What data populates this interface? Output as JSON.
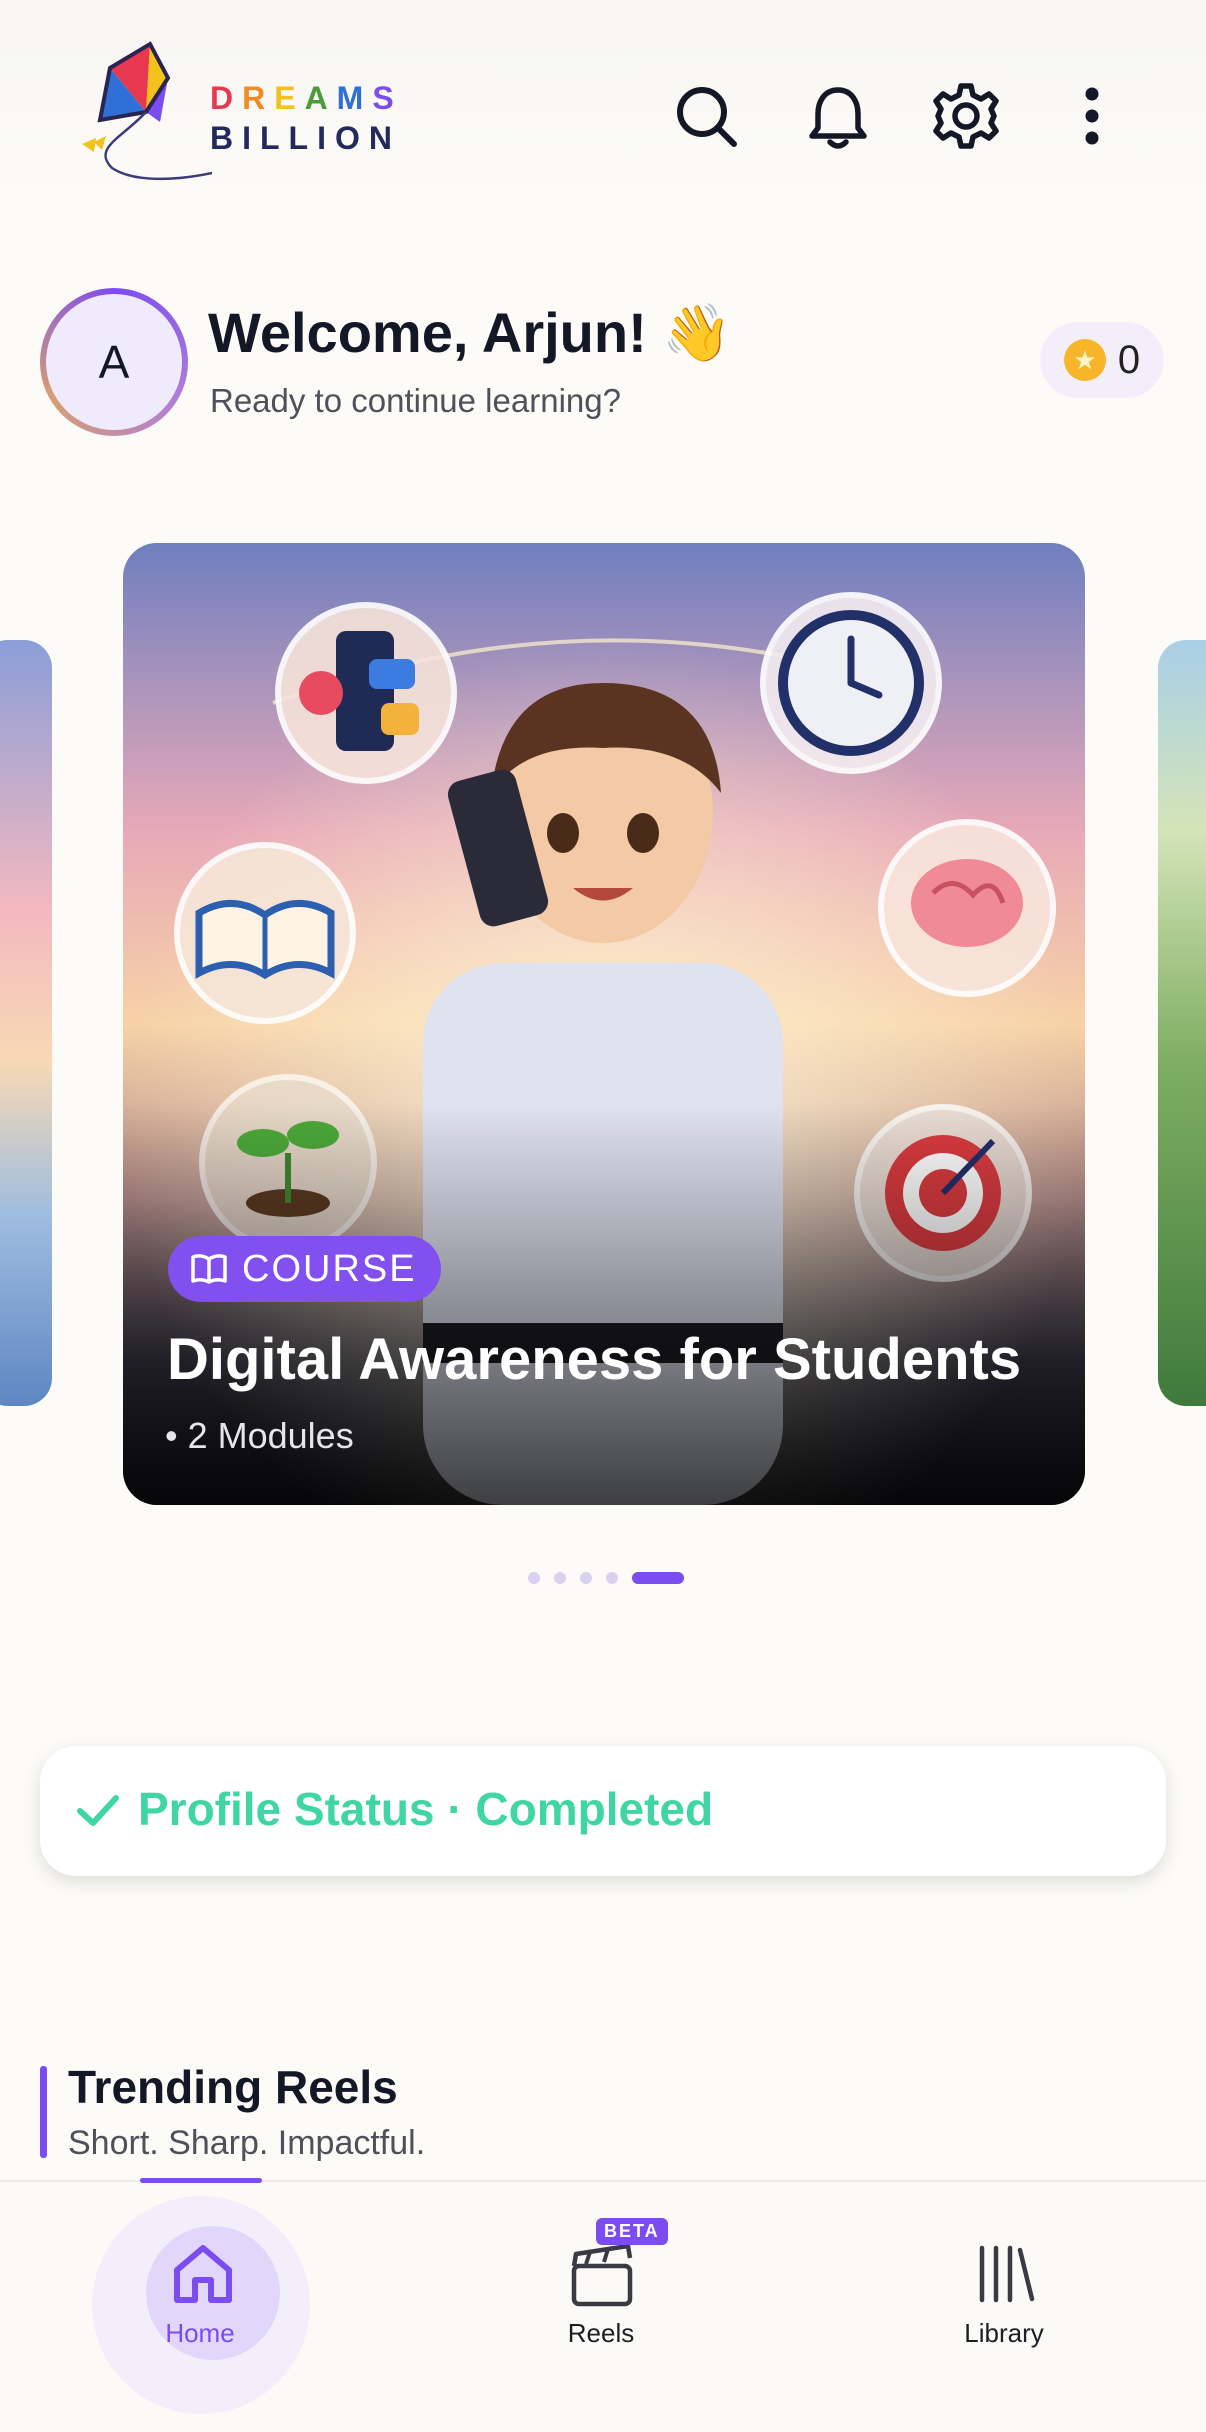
{
  "brand": {
    "line1": "DREAMS",
    "line2": "BILLION"
  },
  "header": {
    "icons": [
      "search-icon",
      "bell-icon",
      "gear-icon",
      "more-vertical-icon"
    ]
  },
  "user": {
    "initial": "A",
    "welcome": "Welcome, Arjun! 👋",
    "subtitle": "Ready to continue learning?",
    "points": "0"
  },
  "carousel": {
    "badge": "COURSE",
    "title": "Digital Awareness for Students",
    "meta": "• 2 Modules",
    "slide_count": 5,
    "active_index": 4
  },
  "profile_status": {
    "text": "Profile Status · Completed"
  },
  "trending": {
    "title": "Trending Reels",
    "subtitle": "Short. Sharp. Impactful."
  },
  "bottom_nav": {
    "items": [
      {
        "label": "Home",
        "icon": "home-icon",
        "active": true
      },
      {
        "label": "Reels",
        "icon": "clapperboard-icon",
        "badge": "BETA",
        "active": false
      },
      {
        "label": "Library",
        "icon": "library-icon",
        "active": false
      }
    ]
  },
  "colors": {
    "accent": "#7b4cf0",
    "success": "#3fd6a4",
    "background": "#fcfbf7",
    "coin": "#f7b52a"
  }
}
